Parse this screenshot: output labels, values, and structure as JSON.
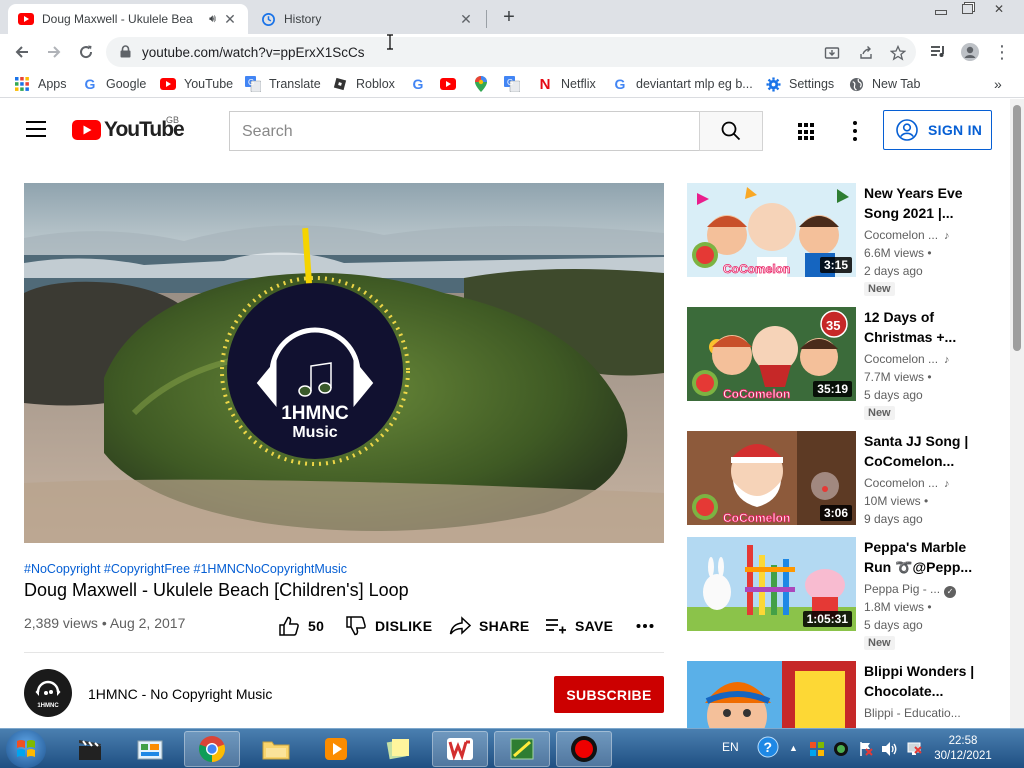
{
  "browser": {
    "tabs": [
      {
        "title": "Doug Maxwell - Ukulele Bea",
        "active": true,
        "icon": "youtube-icon",
        "audio": true
      },
      {
        "title": "History",
        "active": false,
        "icon": "history-icon"
      }
    ],
    "new_tab_symbol": "+",
    "url": "youtube.com/watch?v=ppErxX1ScCs",
    "bookmarks": [
      {
        "label": "Apps",
        "icon": "apps-grid-icon"
      },
      {
        "label": "Google",
        "icon": "google-icon"
      },
      {
        "label": "YouTube",
        "icon": "youtube-icon"
      },
      {
        "label": "Translate",
        "icon": "translate-icon"
      },
      {
        "label": "Roblox",
        "icon": "roblox-icon"
      },
      {
        "label": "",
        "icon": "google-icon"
      },
      {
        "label": "",
        "icon": "youtube-icon"
      },
      {
        "label": "",
        "icon": "maps-pin-icon"
      },
      {
        "label": "",
        "icon": "translate-icon"
      },
      {
        "label": "Netflix",
        "icon": "netflix-icon"
      },
      {
        "label": "deviantart mlp eg b...",
        "icon": "google-icon"
      },
      {
        "label": "Settings",
        "icon": "gear-icon"
      },
      {
        "label": "New Tab",
        "icon": "globe-icon"
      }
    ],
    "more_bookmarks": "»"
  },
  "youtube": {
    "logo_text": "YouTube",
    "region": "GB",
    "search_placeholder": "Search",
    "sign_in_label": "SIGN IN"
  },
  "video": {
    "hashtags": "#NoCopyright #CopyrightFree #1HMNCNoCopyrightMusic",
    "title": "Doug Maxwell - Ukulele Beach [Children's] Loop",
    "stats": "2,389 views • Aug 2, 2017",
    "likes": "50",
    "dislike_label": "DISLIKE",
    "share_label": "SHARE",
    "save_label": "SAVE",
    "logo_line1": "1HMNC",
    "logo_line2": "Music",
    "channel_name": "1HMNC - No Copyright Music",
    "channel_avatar_text": "1HMNC",
    "subscribe_label": "SUBSCRIBE"
  },
  "related": [
    {
      "title": "New Years Eve Song 2021 |...",
      "channel": "Cocomelon ...",
      "views": "6.6M views •",
      "date": "2 days ago",
      "badge": "New",
      "duration": "3:15",
      "thumb_badge": "",
      "channel_mark": "music-note-icon"
    },
    {
      "title": "12 Days of Christmas +...",
      "channel": "Cocomelon ...",
      "views": "7.7M views •",
      "date": "5 days ago",
      "badge": "New",
      "duration": "35:19",
      "thumb_badge": "35",
      "channel_mark": "music-note-icon"
    },
    {
      "title": "Santa JJ Song | CoComelon...",
      "channel": "Cocomelon ...",
      "views": "10M views •",
      "date": "9 days ago",
      "badge": "",
      "duration": "3:06",
      "thumb_badge": "",
      "channel_mark": "music-note-icon"
    },
    {
      "title": "Peppa's Marble Run ➰@Pepp...",
      "channel": "Peppa Pig - ...",
      "views": "1.8M views •",
      "date": "5 days ago",
      "badge": "New",
      "duration": "1:05:31",
      "thumb_badge": "",
      "channel_mark": "verified-icon"
    },
    {
      "title": "Blippi Wonders | Chocolate...",
      "channel": "Blippi - Educatio...",
      "views": "",
      "date": "",
      "badge": "",
      "duration": "",
      "thumb_badge": "",
      "channel_mark": ""
    }
  ],
  "taskbar": {
    "language": "EN",
    "time": "22:58",
    "date": "30/12/2021",
    "apps": [
      "clapperboard-icon",
      "control-panel-icon",
      "chrome-icon",
      "folder-icon",
      "media-player-icon",
      "sticky-notes-icon",
      "wps-icon",
      "solitaire-icon",
      "record-icon"
    ]
  },
  "colors": {
    "youtube_red": "#ff0000",
    "link_blue": "#065fd4",
    "subscribe_red": "#cc0000",
    "taskbar_blue": "#2a5f93"
  }
}
